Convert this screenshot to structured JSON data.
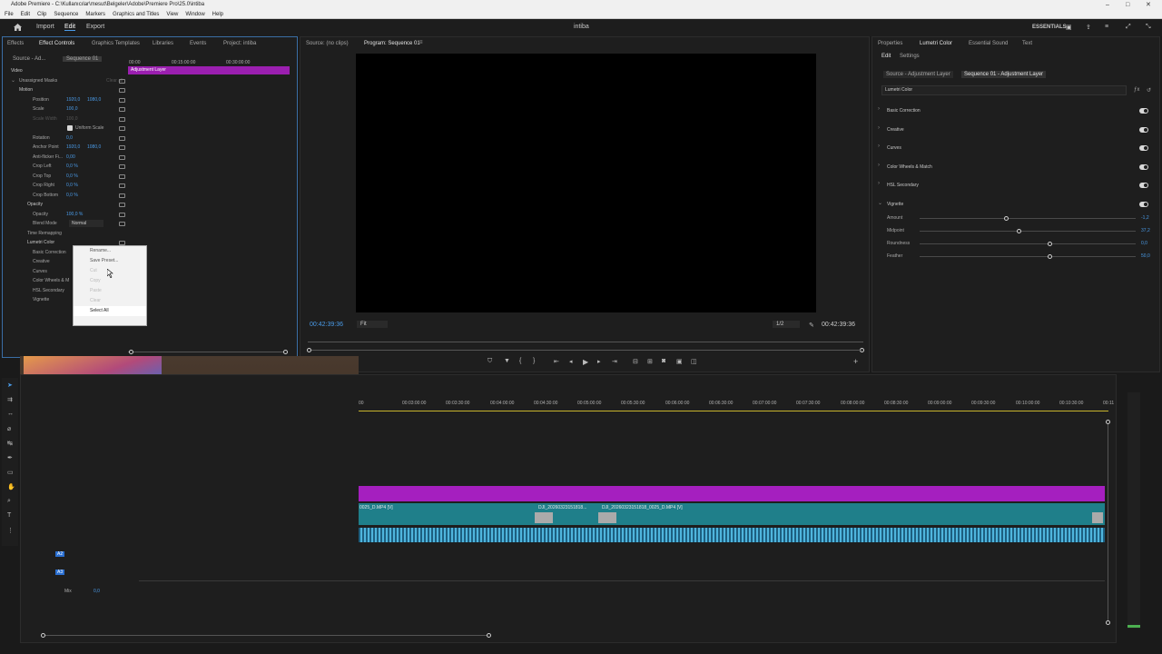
{
  "window": {
    "title": "Adobe Premiere - C:\\Kullanıcılar\\mesut\\Belgeler\\Adobe\\Premiere Pro\\25.0\\intiba"
  },
  "menu": [
    "File",
    "Edit",
    "Clip",
    "Sequence",
    "Markers",
    "Graphics and Titles",
    "View",
    "Window",
    "Help"
  ],
  "appbar": {
    "home_icon": "home-icon",
    "import": "Import",
    "edit": "Edit",
    "export": "Export",
    "project": "intiba",
    "workspace": "ESSENTIALS"
  },
  "effect_controls": {
    "tabs": [
      "Effects",
      "Effect Controls",
      "Graphics Templates",
      "Libraries",
      "Events",
      "Project: intiba"
    ],
    "source_label": "Source - Ad...",
    "sequence_label": "Sequence 01",
    "times": [
      "00:00",
      "00:15:00:00",
      "00:30:00:00"
    ],
    "clip_bar": "Adjustment Layer",
    "video_label": "Video",
    "unassigned_masks": "Unassigned Masks",
    "clear_all": "Clear all",
    "motion": "Motion",
    "position": "Position",
    "position_x": "1920,0",
    "position_y": "1080,0",
    "scale": "Scale",
    "scale_val": "100,0",
    "scale_width": "Scale Width",
    "scale_width_val": "100,0",
    "uniform_scale": "Uniform Scale",
    "rotation": "Rotation",
    "rotation_val": "0,0",
    "anchor": "Anchor Point",
    "anchor_x": "1920,0",
    "anchor_y": "1080,0",
    "antiflicker": "Anti-flicker Fi...",
    "antiflicker_val": "0,00",
    "crop_left": "Crop Left",
    "crop_left_val": "0,0 %",
    "crop_top": "Crop Top",
    "crop_top_val": "0,0 %",
    "crop_right": "Crop Right",
    "crop_right_val": "0,0 %",
    "crop_bottom": "Crop Bottom",
    "crop_bottom_val": "0,0 %",
    "opacity_section": "Opacity",
    "opacity": "Opacity",
    "opacity_val": "100,0 %",
    "blend_mode": "Blend Mode",
    "blend_mode_val": "Normal",
    "time_remapping": "Time Remapping",
    "lumetri": "Lumetri Color",
    "basic": "Basic Correction",
    "creative": "Creative",
    "curves": "Curves",
    "color_wheels": "Color Wheels & M",
    "hsl": "HSL Secondary",
    "vignette": "Vignette",
    "current_time": "00:42"
  },
  "context_menu": [
    "Rename...",
    "Save Preset...",
    "Cut",
    "Copy",
    "Paste",
    "Clear",
    "Select All"
  ],
  "source_monitor": {
    "tab": "Source: (no clips)"
  },
  "program_monitor": {
    "tab": "Program: Sequence 01",
    "timecode": "00:42:39:36",
    "fit": "Fit",
    "resolution": "1/2",
    "duration": "00:42:39:36"
  },
  "right_panel": {
    "tabs": [
      "Properties",
      "Lumetri Color",
      "Essential Sound",
      "Text"
    ],
    "subtabs": [
      "Edit",
      "Settings"
    ],
    "source": "Source - Adjustment Layer",
    "sequence": "Sequence 01 - Adjustment Layer",
    "effect_dropdown": "Lumetri Color",
    "sections": [
      "Basic Correction",
      "Creative",
      "Curves",
      "Color Wheels & Match",
      "HSL Secondary",
      "Vignette"
    ],
    "vignette_params": [
      {
        "label": "Amount",
        "value": "-1,2",
        "level": 0.4
      },
      {
        "label": "Midpoint",
        "value": "37,2",
        "level": 0.46
      },
      {
        "label": "Roundness",
        "value": "0,0",
        "level": 0.6
      },
      {
        "label": "Feather",
        "value": "50,0",
        "level": 0.6
      }
    ]
  },
  "timeline": {
    "ruler": [
      "00",
      "00:03:00:00",
      "00:03:30:00",
      "00:04:00:00",
      "00:04:30:00",
      "00:05:00:00",
      "00:05:30:00",
      "00:06:00:00",
      "00:06:30:00",
      "00:07:00:00",
      "00:07:30:00",
      "00:08:00:00",
      "00:08:30:00",
      "00:09:00:00",
      "00:09:30:00",
      "00:10:00:00",
      "00:10:30:00",
      "00:11"
    ],
    "clip1": "0025_D.MP4 [V]",
    "clip2": "DJI_20260323151818...",
    "clip3": "DJI_20260323151818_0025_D.MP4 [V]",
    "tracks": [
      {
        "name": "A2"
      },
      {
        "name": "A3"
      },
      {
        "name": "Mix",
        "value": "0,0"
      }
    ]
  }
}
